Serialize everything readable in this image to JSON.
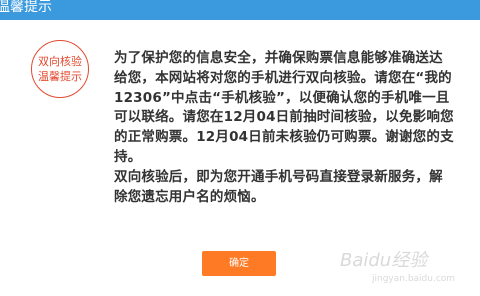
{
  "dialog": {
    "title": "温馨提示",
    "stamp": {
      "line1": "双向核验",
      "line2": "温馨提示",
      "color": "#e34a2f"
    },
    "message": {
      "paragraph1": "为了保护您的信息安全，并确保购票信息能够准确送达给您，本网站将对您的手机进行双向核验。请您在“我的12306”中点击“手机核验”，以便确认您的手机唯一且可以联络。请您在12月04日前抽时间核验，以免影响您的正常购票。12月04日前未核验仍可购票。谢谢您的支持。",
      "paragraph2": "双向核验后，即为您开通手机号码直接登录新服务，解除您遗忘用户名的烦恼。"
    },
    "ok_button_label": "确定",
    "colors": {
      "title_bar": "#3b99de",
      "button": "#ff7a24",
      "text": "#333333"
    }
  },
  "watermark": {
    "text": "Baidu经验",
    "sub": "jingyan.baidu.com"
  }
}
